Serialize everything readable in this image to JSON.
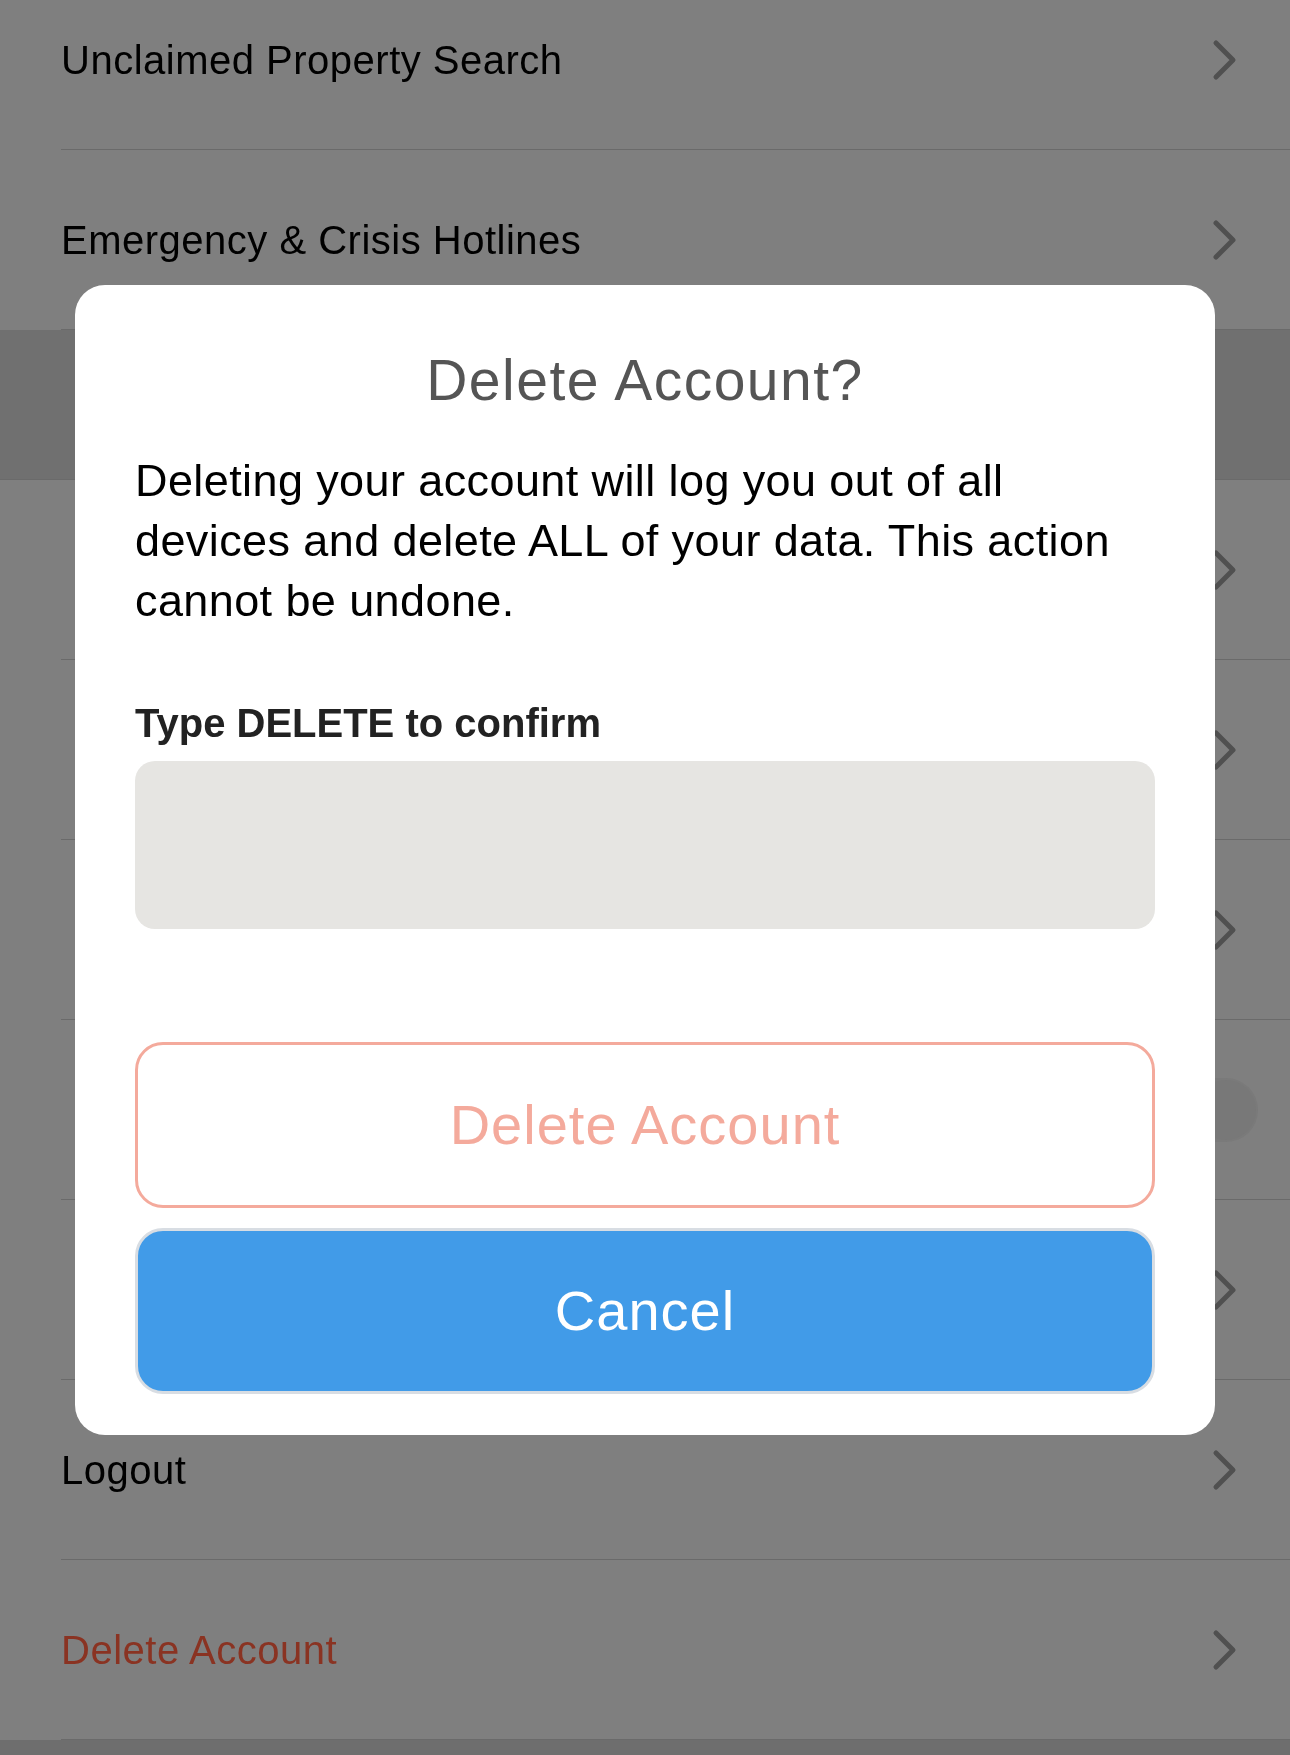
{
  "menu": {
    "items": [
      {
        "label": "Unclaimed Property Search",
        "kind": "link"
      },
      {
        "label": "Emergency & Crisis Hotlines",
        "kind": "link"
      },
      {
        "kind": "header"
      },
      {
        "kind": "link"
      },
      {
        "kind": "link"
      },
      {
        "kind": "link"
      },
      {
        "kind": "switch",
        "on": true
      },
      {
        "kind": "link"
      },
      {
        "label": "Logout",
        "kind": "link"
      },
      {
        "label": "Delete Account",
        "kind": "danger"
      }
    ]
  },
  "dialog": {
    "title": "Delete Account?",
    "message": "Deleting your account will log you out of all devices and delete ALL of your data. This action cannot be undone.",
    "field_label": "Type DELETE to confirm",
    "buttons": [
      {
        "label": "Delete Account",
        "kind": "destructive",
        "disabled": true
      },
      {
        "label": "Cancel",
        "kind": "primary",
        "disabled": false
      }
    ]
  }
}
